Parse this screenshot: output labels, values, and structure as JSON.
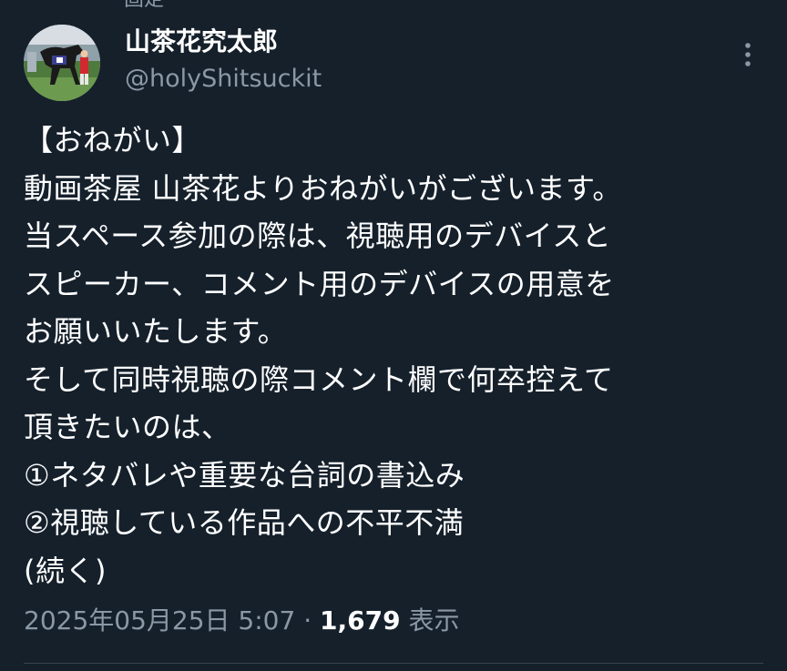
{
  "header": {
    "pinned_label": "固定"
  },
  "author": {
    "display_name": "山茶花究太郎",
    "handle": "@holyShitsuckit",
    "avatar_icon": "horse-photo-avatar"
  },
  "tweet": {
    "lines": [
      "【おねがい】",
      "動画茶屋 山茶花よりおねがいがございます。",
      "当スペース参加の際は、視聴用のデバイスと",
      "スピーカー、コメント用のデバイスの用意を",
      "お願いいたします。",
      "そして同時視聴の際コメント欄で何卒控えて",
      "頂きたいのは、",
      "①ネタバレや重要な台詞の書込み",
      "②視聴している作品への不平不満",
      "(続く)"
    ]
  },
  "meta": {
    "timestamp": "2025年05月25日 5:07",
    "separator": " · ",
    "views_count": "1,679",
    "views_label": " 表示"
  },
  "colors": {
    "background": "#15202b",
    "primary_text": "#ffffff",
    "secondary_text": "#8b98a5",
    "divider": "#38444d"
  },
  "icons": {
    "more": "more-vertical-icon"
  }
}
